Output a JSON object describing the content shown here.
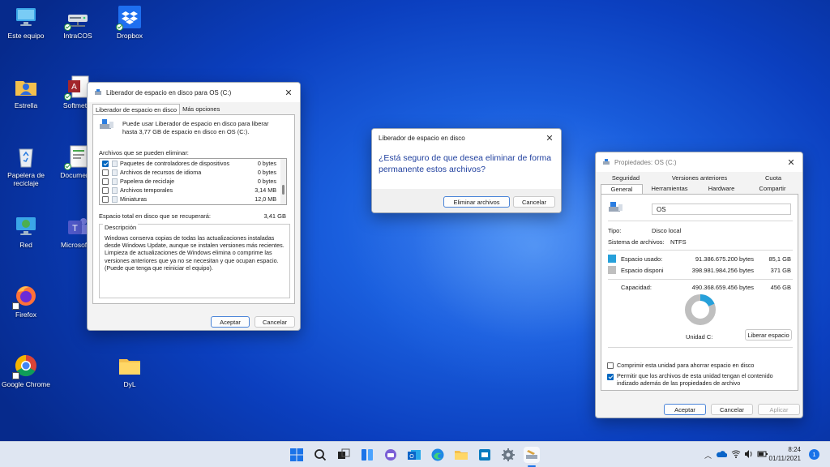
{
  "desktop": {
    "icons": [
      {
        "label": "Este equipo"
      },
      {
        "label": "IntraCOS"
      },
      {
        "label": "Dropbox"
      },
      {
        "label": "Estrella"
      },
      {
        "label": "Softmetry"
      },
      {
        "label": "Papelera de reciclaje"
      },
      {
        "label": "Documento"
      },
      {
        "label": "Red"
      },
      {
        "label": "Microsoft T"
      },
      {
        "label": "Firefox"
      },
      {
        "label": "Google Chrome"
      },
      {
        "label": "DyL"
      }
    ]
  },
  "cleanup": {
    "title": "Liberador de espacio en disco para OS (C:)",
    "tabs": [
      "Liberador de espacio en disco",
      "Más opciones"
    ],
    "intro": "Puede usar Liberador de espacio en disco para liberar hasta 3,77 GB de espacio en disco en OS (C:).",
    "files_label": "Archivos que se pueden eliminar:",
    "files": [
      {
        "name": "Paquetes de controladores de dispositivos",
        "size": "0 bytes",
        "checked": true
      },
      {
        "name": "Archivos de recursos de idioma",
        "size": "0 bytes",
        "checked": false
      },
      {
        "name": "Papelera de reciclaje",
        "size": "0 bytes",
        "checked": false
      },
      {
        "name": "Archivos temporales",
        "size": "3,14 MB",
        "checked": false
      },
      {
        "name": "Miniaturas",
        "size": "12,0 MB",
        "checked": false
      }
    ],
    "total_label": "Espacio total en disco que se recuperará:",
    "total_value": "3,41 GB",
    "desc_label": "Descripción",
    "desc_text": "Windows conserva copias de todas las actualizaciones instaladas desde Windows Update, aunque se instalen versiones más recientes. Limpieza de actualizaciones de Windows elimina o comprime las versiones anteriores que ya no se necesitan y que ocupan espacio. (Puede que tenga que reiniciar el equipo).",
    "ok": "Aceptar",
    "cancel": "Cancelar"
  },
  "confirm": {
    "title": "Liberador de espacio en disco",
    "message": "¿Está seguro de que desea eliminar de forma permanente estos archivos?",
    "delete": "Eliminar archivos",
    "cancel": "Cancelar"
  },
  "props": {
    "title": "Propiedades: OS (C:)",
    "tabs_row1": [
      "Seguridad",
      "Versiones anteriores",
      "Cuota"
    ],
    "tabs_row2": [
      "General",
      "Herramientas",
      "Hardware",
      "Compartir"
    ],
    "name_value": "OS",
    "type_label": "Tipo:",
    "type_value": "Disco local",
    "fs_label": "Sistema de archivos:",
    "fs_value": "NTFS",
    "used_label": "Espacio usado:",
    "used_bytes": "91.386.675.200 bytes",
    "used_gb": "85,1 GB",
    "free_label": "Espacio disponi",
    "free_bytes": "398.981.984.256 bytes",
    "free_gb": "371 GB",
    "cap_label": "Capacidad:",
    "cap_bytes": "490.368.659.456 bytes",
    "cap_gb": "456 GB",
    "used_fraction": 0.186,
    "used_color": "#26a0da",
    "free_color": "#bfbfbf",
    "drive_label": "Unidad C:",
    "free_button": "Liberar espacio",
    "compress_label": "Comprimir esta unidad para ahorrar espacio en disco",
    "compress_checked": false,
    "index_label": "Permitir que los archivos de esta unidad tengan el contenido indizado además de las propiedades de archivo",
    "index_checked": true,
    "ok": "Aceptar",
    "cancel": "Cancelar",
    "apply": "Aplicar"
  },
  "taskbar": {
    "time": "8:24",
    "date": "01/11/2021",
    "notif_count": "1"
  }
}
